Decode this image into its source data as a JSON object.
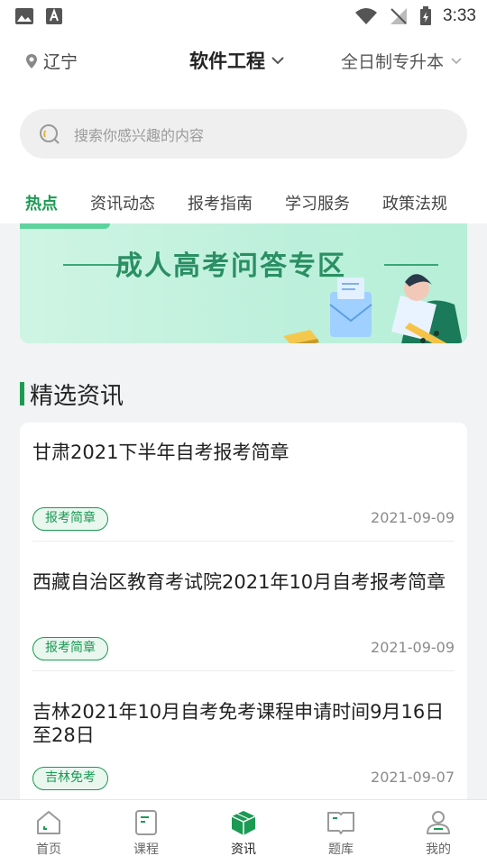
{
  "status_bar": {
    "time": "3:33"
  },
  "header": {
    "location": "辽宁",
    "major": "软件工程",
    "education": "全日制专升本"
  },
  "search": {
    "placeholder": "搜索你感兴趣的内容"
  },
  "tabs": [
    {
      "label": "热点",
      "active": true
    },
    {
      "label": "资讯动态",
      "active": false
    },
    {
      "label": "报考指南",
      "active": false
    },
    {
      "label": "学习服务",
      "active": false
    },
    {
      "label": "政策法规",
      "active": false
    }
  ],
  "banner": {
    "title": "成人高考问答专区"
  },
  "section": {
    "title": "精选资讯"
  },
  "news": [
    {
      "title": "甘肃2021下半年自考报考简章",
      "tag": "报考简章",
      "date": "2021-09-09"
    },
    {
      "title": "西藏自治区教育考试院2021年10月自考报考简章",
      "tag": "报考简章",
      "date": "2021-09-09"
    },
    {
      "title": "吉林2021年10月自考免考课程申请时间9月16日至28日",
      "tag": "吉林免考",
      "date": "2021-09-07"
    }
  ],
  "bottom_nav": [
    {
      "label": "首页",
      "icon": "home-icon",
      "active": false
    },
    {
      "label": "课程",
      "icon": "course-icon",
      "active": false
    },
    {
      "label": "资讯",
      "icon": "news-icon",
      "active": true
    },
    {
      "label": "题库",
      "icon": "question-bank-icon",
      "active": false
    },
    {
      "label": "我的",
      "icon": "profile-icon",
      "active": false
    }
  ],
  "colors": {
    "accent": "#1b9a53",
    "background": "#f2f3f5"
  }
}
